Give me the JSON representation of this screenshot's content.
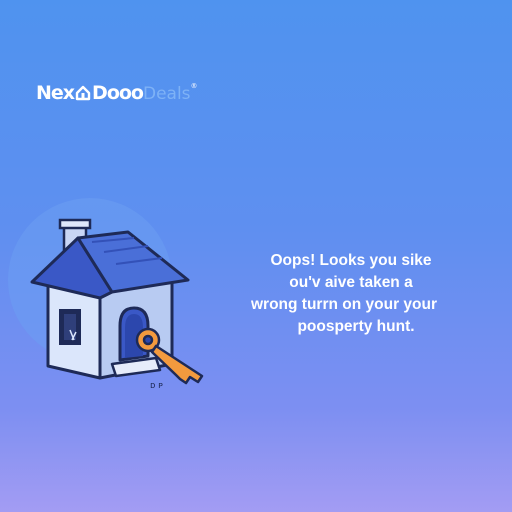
{
  "brand": {
    "part1": "Nex",
    "part2": "Dooo",
    "part3": "Deals",
    "reg": "®",
    "logo_icon": "house-key-icon"
  },
  "message": {
    "line1": "Oops! Looks you sike",
    "line2": "ou'v aive taken a",
    "line3": "wrong turrn on your  your",
    "line4": "poosperty hunt."
  },
  "illustration": {
    "icon": "house-with-key-icon",
    "caption": "ᴅ ᴘ"
  },
  "colors": {
    "background_top": "#4f93ef",
    "background_bottom": "#a39cf3",
    "roof": "#3d5fd0",
    "house_wall": "#dbe6fb",
    "key": "#f39a3e",
    "outline": "#1e2a57"
  }
}
